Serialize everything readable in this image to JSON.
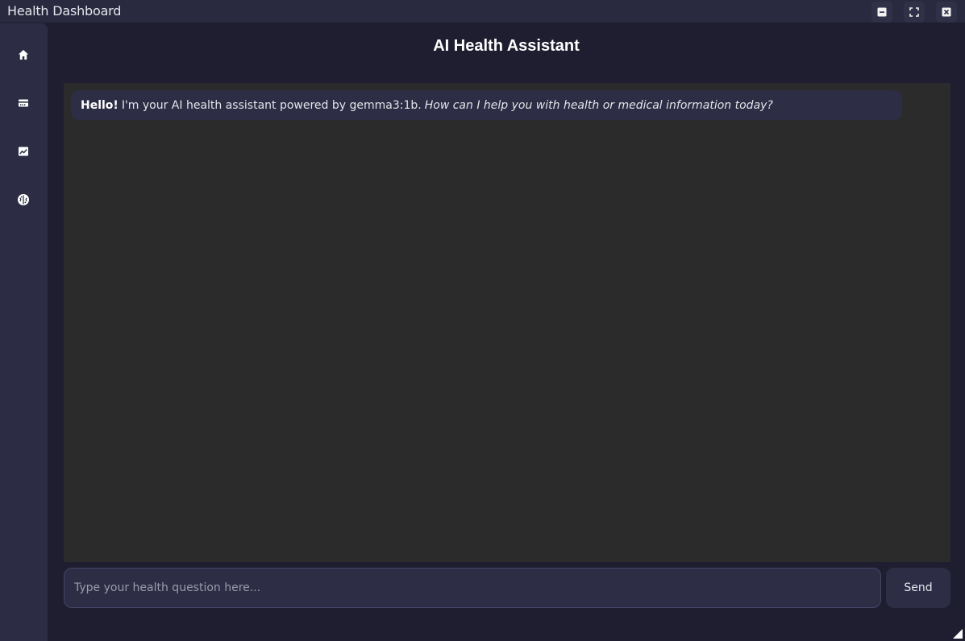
{
  "window": {
    "title": "Health Dashboard",
    "controls": [
      "minimize-icon",
      "maximize-icon",
      "close-icon"
    ]
  },
  "sidebar": {
    "items": [
      {
        "name": "home",
        "icon": "home-icon"
      },
      {
        "name": "records",
        "icon": "card-icon"
      },
      {
        "name": "charts",
        "icon": "chart-icon"
      },
      {
        "name": "ai-assistant",
        "icon": "brain-icon"
      }
    ]
  },
  "header": {
    "title": "AI Health Assistant"
  },
  "chat": {
    "messages": [
      {
        "greeting": "Hello!",
        "text": "I'm your AI health assistant powered by gemma3:1b.",
        "question": "How can I help you with health or medical information today?"
      }
    ]
  },
  "input": {
    "value": "",
    "placeholder": "Type your health question here..."
  },
  "send": {
    "label": "Send"
  },
  "colors": {
    "background": "#1f1e30",
    "sidebar": "#2c2c44",
    "chat_area": "#2b2b2b",
    "bubble": "#2d2d45"
  }
}
